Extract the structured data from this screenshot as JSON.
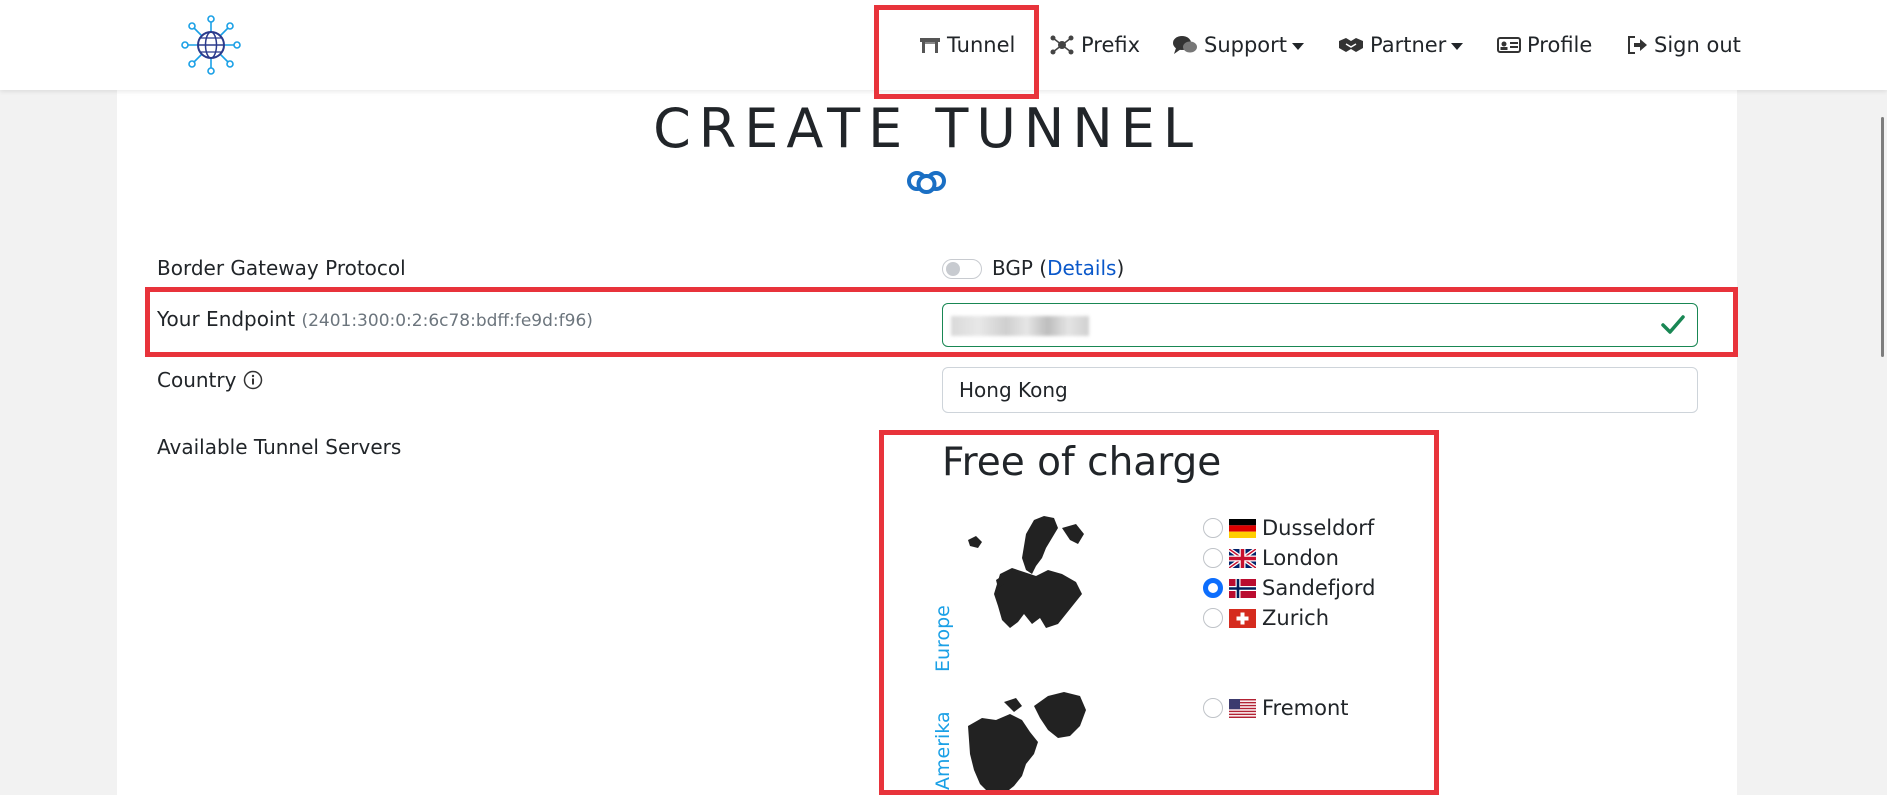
{
  "nav": {
    "items": [
      {
        "label": "Tunnel",
        "icon": "tunnel-icon"
      },
      {
        "label": "Prefix",
        "icon": "network-icon"
      },
      {
        "label": "Support",
        "icon": "chat-icon",
        "dropdown": true
      },
      {
        "label": "Partner",
        "icon": "handshake-icon",
        "dropdown": true
      },
      {
        "label": "Profile",
        "icon": "id-card-icon"
      },
      {
        "label": "Sign out",
        "icon": "sign-out-icon"
      }
    ]
  },
  "page": {
    "title": "CREATE TUNNEL"
  },
  "form": {
    "bgp_label": "Border Gateway Protocol",
    "bgp_toggle_text": "BGP (",
    "bgp_details_link": "Details",
    "bgp_close": ")",
    "bgp_enabled": false,
    "endpoint_label": "Your Endpoint",
    "endpoint_hint": "(2401:300:0:2:6c78:bdff:fe9d:f96)",
    "endpoint_value": "",
    "endpoint_status": "valid",
    "country_label": "Country",
    "country_value": "Hong Kong",
    "servers_label": "Available Tunnel Servers"
  },
  "servers": {
    "heading": "Free of charge",
    "groups": [
      {
        "region": "Europe",
        "items": [
          {
            "name": "Dusseldorf",
            "flag": "de",
            "selected": false
          },
          {
            "name": "London",
            "flag": "gb",
            "selected": false
          },
          {
            "name": "Sandefjord",
            "flag": "no",
            "selected": true
          },
          {
            "name": "Zurich",
            "flag": "ch",
            "selected": false
          }
        ]
      },
      {
        "region": "Amerika",
        "items": [
          {
            "name": "Fremont",
            "flag": "us",
            "selected": false
          }
        ]
      }
    ]
  },
  "colors": {
    "accent": "#1aa0e6",
    "highlight": "#e8333b",
    "valid": "#198754",
    "link": "#0a58ca",
    "radio_checked": "#0d6efd"
  }
}
